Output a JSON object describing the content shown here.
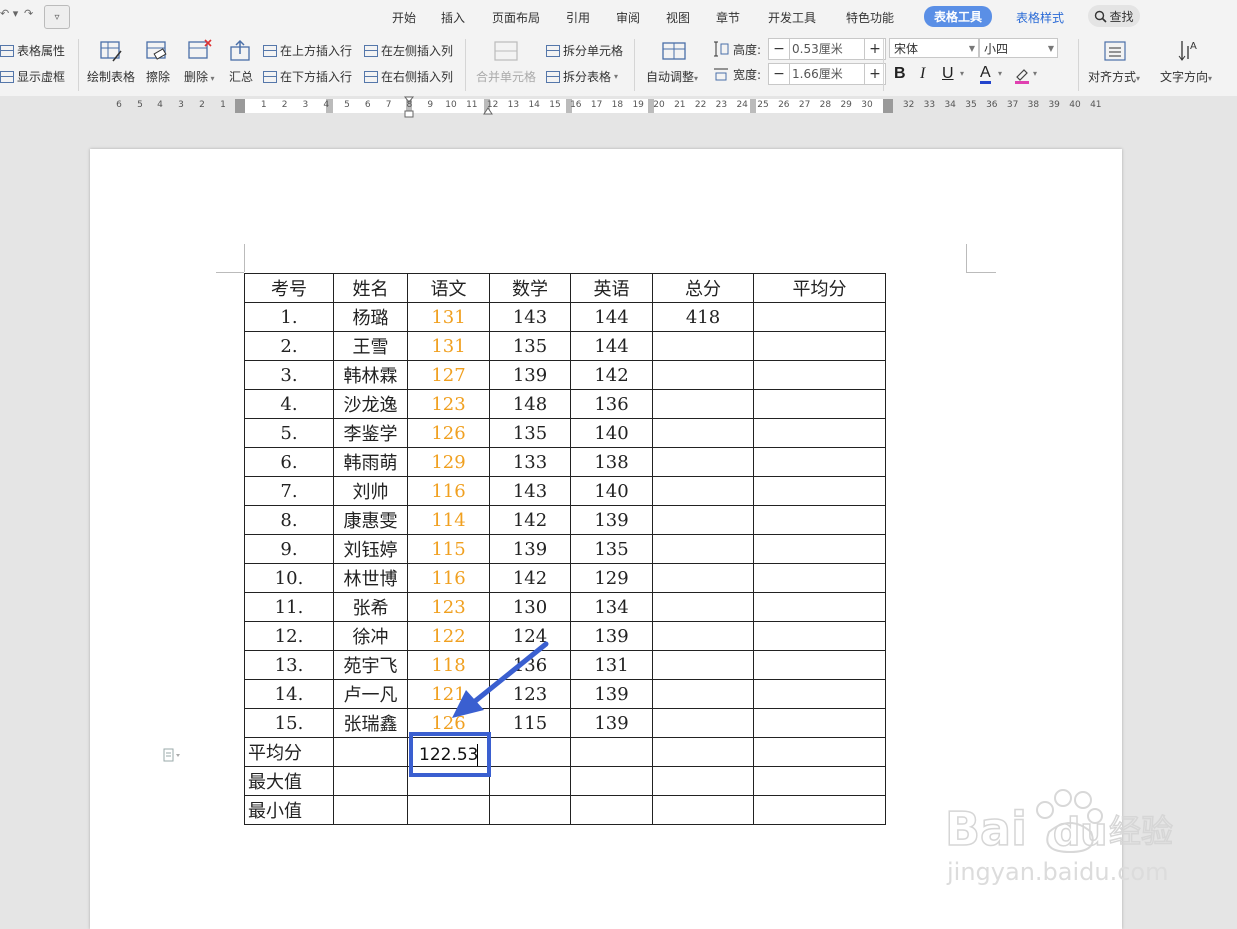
{
  "menubar": {
    "tabs": [
      "开始",
      "插入",
      "页面布局",
      "引用",
      "审阅",
      "视图",
      "章节",
      "开发工具",
      "特色功能"
    ],
    "active_tab": "表格工具",
    "extra_tab": "表格样式",
    "search_label": "查找"
  },
  "toolbar": {
    "table_properties": "表格属性",
    "show_gridlines": "显示虚框",
    "draw_table": "绘制表格",
    "erase": "擦除",
    "delete": "删除",
    "summary": "汇总",
    "insert_row_above": "在上方插入行",
    "insert_row_below": "在下方插入行",
    "insert_col_left": "在左侧插入列",
    "insert_col_right": "在右侧插入列",
    "merge_cells": "合并单元格",
    "split_cells": "拆分单元格",
    "split_table": "拆分表格",
    "auto_fit": "自动调整",
    "height_label": "高度:",
    "height_value": "0.53厘米",
    "width_label": "宽度:",
    "width_value": "1.66厘米",
    "font_name": "宋体",
    "font_size": "小四",
    "bold": "B",
    "italic": "I",
    "underline": "U",
    "font_color": "A",
    "align": "对齐方式",
    "text_direction": "文字方向"
  },
  "ruler": {
    "left_numbers": [
      "6",
      "5",
      "4",
      "3",
      "2",
      "1"
    ],
    "numbers": [
      "1",
      "2",
      "3",
      "4",
      "5",
      "6",
      "7",
      "8",
      "9",
      "10",
      "11",
      "12",
      "13",
      "14",
      "15",
      "16",
      "17",
      "18",
      "19",
      "20",
      "21",
      "22",
      "23",
      "24",
      "25",
      "26",
      "27",
      "28",
      "29",
      "30",
      "32",
      "33",
      "34",
      "35",
      "36",
      "37",
      "38",
      "39",
      "40",
      "41"
    ]
  },
  "table": {
    "headers": [
      "考号",
      "姓名",
      "语文",
      "数学",
      "英语",
      "总分",
      "平均分"
    ],
    "rows": [
      [
        "1.",
        "杨璐",
        "131",
        "143",
        "144",
        "418",
        ""
      ],
      [
        "2.",
        "王雪",
        "131",
        "135",
        "144",
        "",
        ""
      ],
      [
        "3.",
        "韩林霖",
        "127",
        "139",
        "142",
        "",
        ""
      ],
      [
        "4.",
        "沙龙逸",
        "123",
        "148",
        "136",
        "",
        ""
      ],
      [
        "5.",
        "李鉴学",
        "126",
        "135",
        "140",
        "",
        ""
      ],
      [
        "6.",
        "韩雨萌",
        "129",
        "133",
        "138",
        "",
        ""
      ],
      [
        "7.",
        "刘帅",
        "116",
        "143",
        "140",
        "",
        ""
      ],
      [
        "8.",
        "康惠雯",
        "114",
        "142",
        "139",
        "",
        ""
      ],
      [
        "9.",
        "刘钰婷",
        "115",
        "139",
        "135",
        "",
        ""
      ],
      [
        "10.",
        "林世博",
        "116",
        "142",
        "129",
        "",
        ""
      ],
      [
        "11.",
        "张希",
        "123",
        "130",
        "134",
        "",
        ""
      ],
      [
        "12.",
        "徐冲",
        "122",
        "124",
        "139",
        "",
        ""
      ],
      [
        "13.",
        "苑宇飞",
        "118",
        "136",
        "131",
        "",
        ""
      ],
      [
        "14.",
        "卢一凡",
        "121",
        "123",
        "139",
        "",
        ""
      ],
      [
        "15.",
        "张瑞鑫",
        "126",
        "115",
        "139",
        "",
        ""
      ]
    ],
    "footer_labels": [
      "平均分",
      "最大值",
      "最小值"
    ],
    "active_cell_value": "122.53"
  },
  "colors": {
    "chinese_score": "#f0a020",
    "annotation_arrow": "#3a5fd0",
    "active_tab_bg": "#5a8fe6"
  },
  "watermark": {
    "brand": "Baidu经验",
    "url": "jingyan.baidu.com"
  }
}
